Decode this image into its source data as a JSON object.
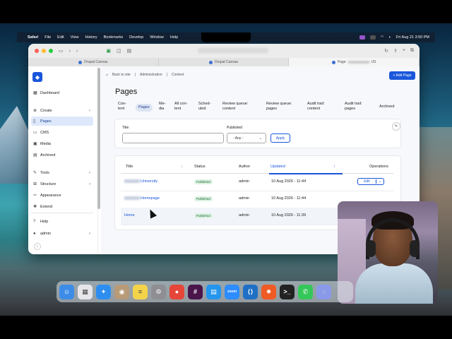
{
  "menubar": {
    "app": "Safari",
    "items": [
      "File",
      "Edit",
      "View",
      "History",
      "Bookmarks",
      "Develop",
      "Window",
      "Help"
    ],
    "clock": "Fri Aug 21  3:50 PM"
  },
  "browser": {
    "tabs": [
      "Drupal Canvas",
      "Drupal Canvas",
      "Page"
    ],
    "tab3_suffix": "US"
  },
  "breadcrumbs": [
    "Back to site",
    "Administration",
    "Content"
  ],
  "add_button": "+ Add Page",
  "page_title": "Pages",
  "sidebar": {
    "items": [
      {
        "label": "Dashboard",
        "icon": "dashboard-icon",
        "chevron": false
      },
      {
        "label": "Create",
        "icon": "plus-circle-icon",
        "chevron": true
      },
      {
        "label": "Pages",
        "icon": "page-icon",
        "chevron": false,
        "active": true
      },
      {
        "label": "CMS",
        "icon": "cms-icon",
        "chevron": false
      },
      {
        "label": "Media",
        "icon": "media-icon",
        "chevron": false
      },
      {
        "label": "Archived",
        "icon": "archive-icon",
        "chevron": false
      },
      {
        "label": "Tools",
        "icon": "wrench-icon",
        "chevron": true
      },
      {
        "label": "Structure",
        "icon": "structure-icon",
        "chevron": true
      },
      {
        "label": "Appearance",
        "icon": "brush-icon",
        "chevron": false
      },
      {
        "label": "Extend",
        "icon": "puzzle-icon",
        "chevron": false
      },
      {
        "label": "Help",
        "icon": "help-icon",
        "chevron": false
      },
      {
        "label": "admin",
        "icon": "user-icon",
        "chevron": true
      }
    ]
  },
  "tabs": [
    {
      "l1": "Con-",
      "l2": "tent"
    },
    {
      "l1": "Pages",
      "l2": "",
      "active": true
    },
    {
      "l1": "Me-",
      "l2": "dia"
    },
    {
      "l1": "All con-",
      "l2": "tent"
    },
    {
      "l1": "Sched-",
      "l2": "uled"
    },
    {
      "l1": "Review queue:",
      "l2": "content"
    },
    {
      "l1": "Review queue:",
      "l2": "pages"
    },
    {
      "l1": "Audit trail:",
      "l2": "content"
    },
    {
      "l1": "Audit trail:",
      "l2": "pages"
    },
    {
      "l1": "Archived",
      "l2": ""
    }
  ],
  "filter": {
    "title_label": "Title",
    "title_value": "",
    "published_label": "Published",
    "published_value": "- Any -",
    "apply": "Apply"
  },
  "table": {
    "headers": {
      "title": "Title",
      "status": "Status",
      "author": "Author",
      "updated": "Updated",
      "operations": "Operations"
    },
    "rows": [
      {
        "title": "University",
        "status": "Published",
        "author": "admin",
        "updated": "10 Aug 2026 - 11:44",
        "op": "Edit",
        "op_caret": "⌄"
      },
      {
        "title": "Homepage",
        "status": "Published",
        "author": "admin",
        "updated": "10 Aug 2026 - 11:44",
        "op": "",
        "op_caret": ""
      },
      {
        "title": "Home",
        "status": "Published",
        "author": "admin",
        "updated": "10 Aug 2026 - 11:39",
        "op": "",
        "op_caret": ""
      }
    ]
  },
  "colors": {
    "accent": "#1a56db",
    "published_bg": "#dcf2e1",
    "published_fg": "#1e6b36",
    "active_nav": "#dde8fb"
  },
  "dock": [
    {
      "name": "finder",
      "color": "#3d8de8",
      "glyph": "☺"
    },
    {
      "name": "launchpad",
      "color": "#e6e6ea",
      "glyph": "▦"
    },
    {
      "name": "safari",
      "color": "#2e8ef0",
      "glyph": "✦"
    },
    {
      "name": "contacts",
      "color": "#b89a78",
      "glyph": "◉"
    },
    {
      "name": "notes",
      "color": "#f3d34a",
      "glyph": "≡"
    },
    {
      "name": "settings",
      "color": "#8e8e93",
      "glyph": "⚙"
    },
    {
      "name": "chrome",
      "color": "#e6463a",
      "glyph": "●"
    },
    {
      "name": "slack",
      "color": "#4a154b",
      "glyph": "#"
    },
    {
      "name": "docker",
      "color": "#2496ed",
      "glyph": "▤"
    },
    {
      "name": "zoom",
      "color": "#2d8cff",
      "glyph": "zoom"
    },
    {
      "name": "vscode",
      "color": "#1f6fc4",
      "glyph": "⟨⟩"
    },
    {
      "name": "postman",
      "color": "#ef5b25",
      "glyph": "✸"
    },
    {
      "name": "terminal",
      "color": "#222222",
      "glyph": ">_"
    },
    {
      "name": "phone",
      "color": "#34c759",
      "glyph": "✆"
    },
    {
      "name": "loader",
      "color": "#8a9ae8",
      "glyph": "◌"
    }
  ]
}
